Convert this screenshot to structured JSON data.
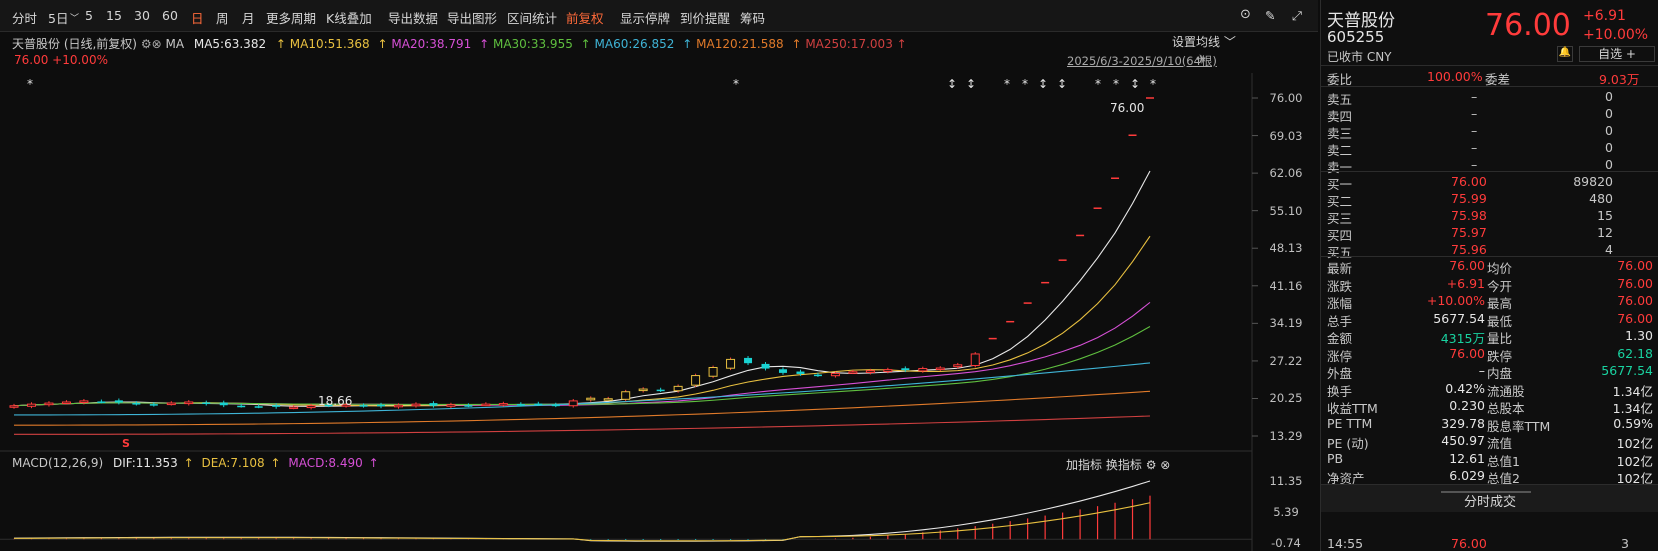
{
  "toolbar": {
    "items": [
      "分时",
      "5日",
      "5",
      "15",
      "30",
      "60",
      "日",
      "周",
      "月",
      "更多周期",
      "K线叠加",
      "导出数据",
      "导出图形",
      "区间统计",
      "前复权",
      "显示停牌",
      "到价提醒",
      "筹码"
    ],
    "active": [
      "日",
      "前复权"
    ]
  },
  "legend": {
    "name": "天普股份 (日线,前复权)",
    "ma": "MA",
    "ma5": "MA5:63.382",
    "ma10": "MA10:51.368",
    "ma20": "MA20:38.791",
    "ma30": "MA30:33.955",
    "ma60": "MA60:26.852",
    "ma120": "MA120:21.588",
    "ma250": "MA250:17.003",
    "setting": "设置均线",
    "range": "2025/6/3-2025/9/10(64根)",
    "price_change": "76.00 +10.00%"
  },
  "price_axis": [
    "76.00",
    "69.03",
    "62.06",
    "55.10",
    "48.13",
    "41.16",
    "34.19",
    "27.22",
    "20.25",
    "13.29"
  ],
  "macd_axis": [
    "11.35",
    "5.39",
    "-0.74"
  ],
  "annotations": {
    "high_label": "76.00",
    "low_label": "18.66",
    "marker_s": "S"
  },
  "macd_legend": {
    "name": "MACD(12,26,9)",
    "dif": "DIF:11.353",
    "dea": "DEA:7.108",
    "macd": "MACD:8.490",
    "add": "加指标",
    "swap": "换指标"
  },
  "colors": {
    "up": "#ff3b3b",
    "down": "#19d2d2",
    "ma5": "#e8e8e8",
    "ma10": "#e8c040",
    "ma20": "#d650d6",
    "ma30": "#5fbf3f",
    "ma60": "#3fb4d6",
    "ma120": "#e07a2a",
    "ma250": "#d04040"
  },
  "chart_data": {
    "type": "candlestick",
    "days": 64,
    "closes": [
      18.9,
      19.2,
      19.4,
      19.6,
      19.8,
      19.7,
      19.5,
      19.3,
      19.1,
      19.4,
      19.6,
      19.3,
      19.0,
      18.9,
      18.8,
      18.7,
      18.66,
      18.9,
      19.0,
      19.1,
      18.9,
      18.8,
      19.0,
      19.2,
      18.9,
      19.1,
      19.0,
      19.2,
      19.3,
      19.1,
      19.2,
      19.0,
      19.8,
      20.3,
      20.2,
      21.5,
      22.0,
      21.8,
      22.5,
      24.5,
      26.0,
      27.5,
      26.8,
      25.8,
      25.0,
      24.8,
      24.6,
      24.9,
      25.2,
      25.4,
      25.6,
      25.5,
      25.8,
      25.9,
      26.5,
      28.51,
      31.36,
      34.5,
      37.95,
      41.74,
      45.91,
      50.5,
      55.55,
      61.11,
      69.09,
      76.0
    ]
  },
  "quote": {
    "name": "天普股份",
    "code": "605255",
    "status": "已收市 CNY",
    "price": "76.00",
    "change": "+6.91",
    "pct": "+10.00%",
    "watch": "自选 +"
  },
  "orderbook": {
    "webi_label": "委比",
    "webi": "100.00%",
    "weicha_label": "委差",
    "weicha": "9.03万",
    "sells": [
      {
        "l": "卖五",
        "p": "–",
        "v": "0"
      },
      {
        "l": "卖四",
        "p": "–",
        "v": "0"
      },
      {
        "l": "卖三",
        "p": "–",
        "v": "0"
      },
      {
        "l": "卖二",
        "p": "–",
        "v": "0"
      },
      {
        "l": "卖一",
        "p": "–",
        "v": "0"
      }
    ],
    "buys": [
      {
        "l": "买一",
        "p": "76.00",
        "v": "89820"
      },
      {
        "l": "买二",
        "p": "75.99",
        "v": "480"
      },
      {
        "l": "买三",
        "p": "75.98",
        "v": "15"
      },
      {
        "l": "买四",
        "p": "75.97",
        "v": "12"
      },
      {
        "l": "买五",
        "p": "75.96",
        "v": "4"
      }
    ]
  },
  "stats": [
    {
      "a": "最新",
      "av": "76.00",
      "ac": "red",
      "b": "均价",
      "bv": "76.00",
      "bc": "red"
    },
    {
      "a": "涨跌",
      "av": "+6.91",
      "ac": "red",
      "b": "今开",
      "bv": "76.00",
      "bc": "red"
    },
    {
      "a": "涨幅",
      "av": "+10.00%",
      "ac": "red",
      "b": "最高",
      "bv": "76.00",
      "bc": "red"
    },
    {
      "a": "总手",
      "av": "5677.54",
      "ac": "white",
      "b": "最低",
      "bv": "76.00",
      "bc": "red"
    },
    {
      "a": "金额",
      "av": "4315万",
      "ac": "green",
      "b": "量比",
      "bv": "1.30",
      "bc": "white"
    },
    {
      "a": "涨停",
      "av": "76.00",
      "ac": "red",
      "b": "跌停",
      "bv": "62.18",
      "bc": "green"
    },
    {
      "a": "外盘",
      "av": "–",
      "ac": "white",
      "b": "内盘",
      "bv": "5677.54",
      "bc": "green"
    },
    {
      "a": "换手",
      "av": "0.42%",
      "ac": "white",
      "b": "流通股",
      "bv": "1.34亿",
      "bc": "white"
    },
    {
      "a": "收益TTM",
      "av": "0.230",
      "ac": "white",
      "b": "总股本",
      "bv": "1.34亿",
      "bc": "white"
    },
    {
      "a": "PE TTM",
      "av": "329.78",
      "ac": "white",
      "b": "股息率TTM",
      "bv": "0.59%",
      "bc": "white"
    },
    {
      "a": "PE (动)",
      "av": "450.97",
      "ac": "white",
      "b": "流值",
      "bv": "102亿",
      "bc": "white"
    },
    {
      "a": "PB",
      "av": "12.61",
      "ac": "white",
      "b": "总值1",
      "bv": "102亿",
      "bc": "white"
    },
    {
      "a": "净资产",
      "av": "6.029",
      "ac": "white",
      "b": "总值2",
      "bv": "102亿",
      "bc": "white"
    }
  ],
  "tick": {
    "title": "分时成交",
    "time": "14:55",
    "price": "76.00",
    "vol": "3"
  }
}
